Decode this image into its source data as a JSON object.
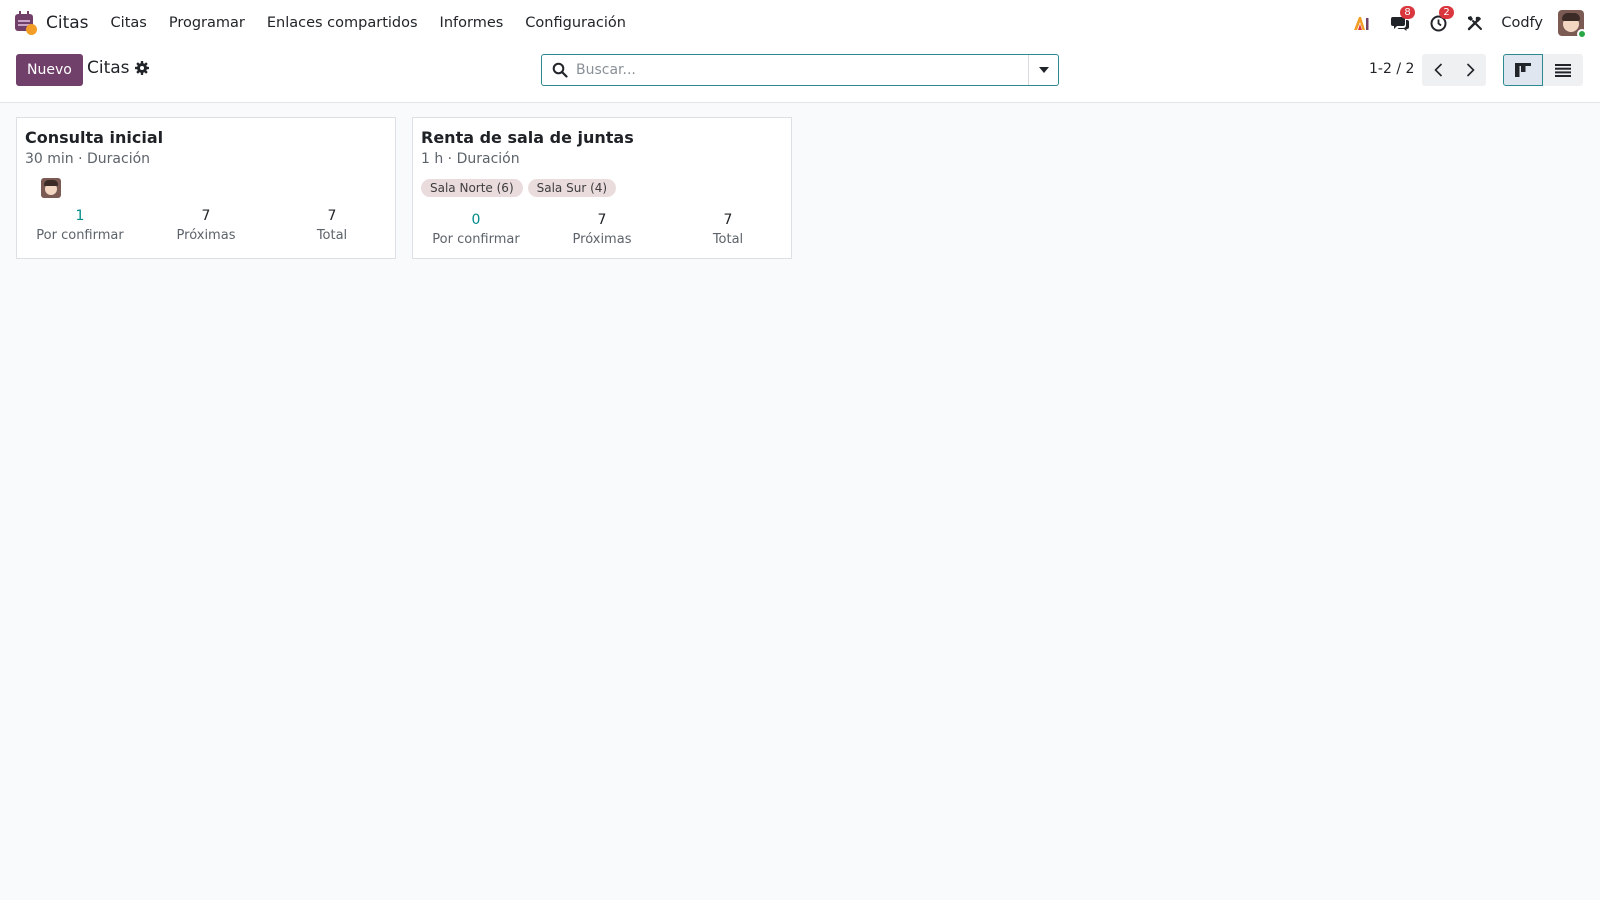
{
  "navbar": {
    "brand": "Citas",
    "menu": [
      "Citas",
      "Programar",
      "Enlaces compartidos",
      "Informes",
      "Configuración"
    ],
    "messages_badge": "8",
    "activities_badge": "2",
    "company": "Codfy",
    "icons": [
      "calendar-app-icon",
      "ai-icon",
      "chat-icon",
      "clock-icon",
      "tools-icon",
      "user-avatar"
    ]
  },
  "control": {
    "new_label": "Nuevo",
    "breadcrumb": "Citas",
    "search_placeholder": "Buscar...",
    "pager": "1-2 / 2"
  },
  "cards": [
    {
      "title": "Consulta inicial",
      "subtitle": "30 min · Duración",
      "stats": [
        {
          "value": "1",
          "label": "Por confirmar"
        },
        {
          "value": "7",
          "label": "Próximas"
        },
        {
          "value": "7",
          "label": "Total"
        }
      ]
    },
    {
      "title": "Renta de sala de juntas",
      "subtitle": "1 h · Duración",
      "tags": [
        "Sala Norte (6)",
        "Sala Sur (4)"
      ],
      "stats": [
        {
          "value": "0",
          "label": "Por confirmar"
        },
        {
          "value": "7",
          "label": "Próximas"
        },
        {
          "value": "7",
          "label": "Total"
        }
      ]
    }
  ],
  "colors": {
    "brand": "#71406a",
    "accent": "#018a8a",
    "badge": "#d9363e"
  }
}
